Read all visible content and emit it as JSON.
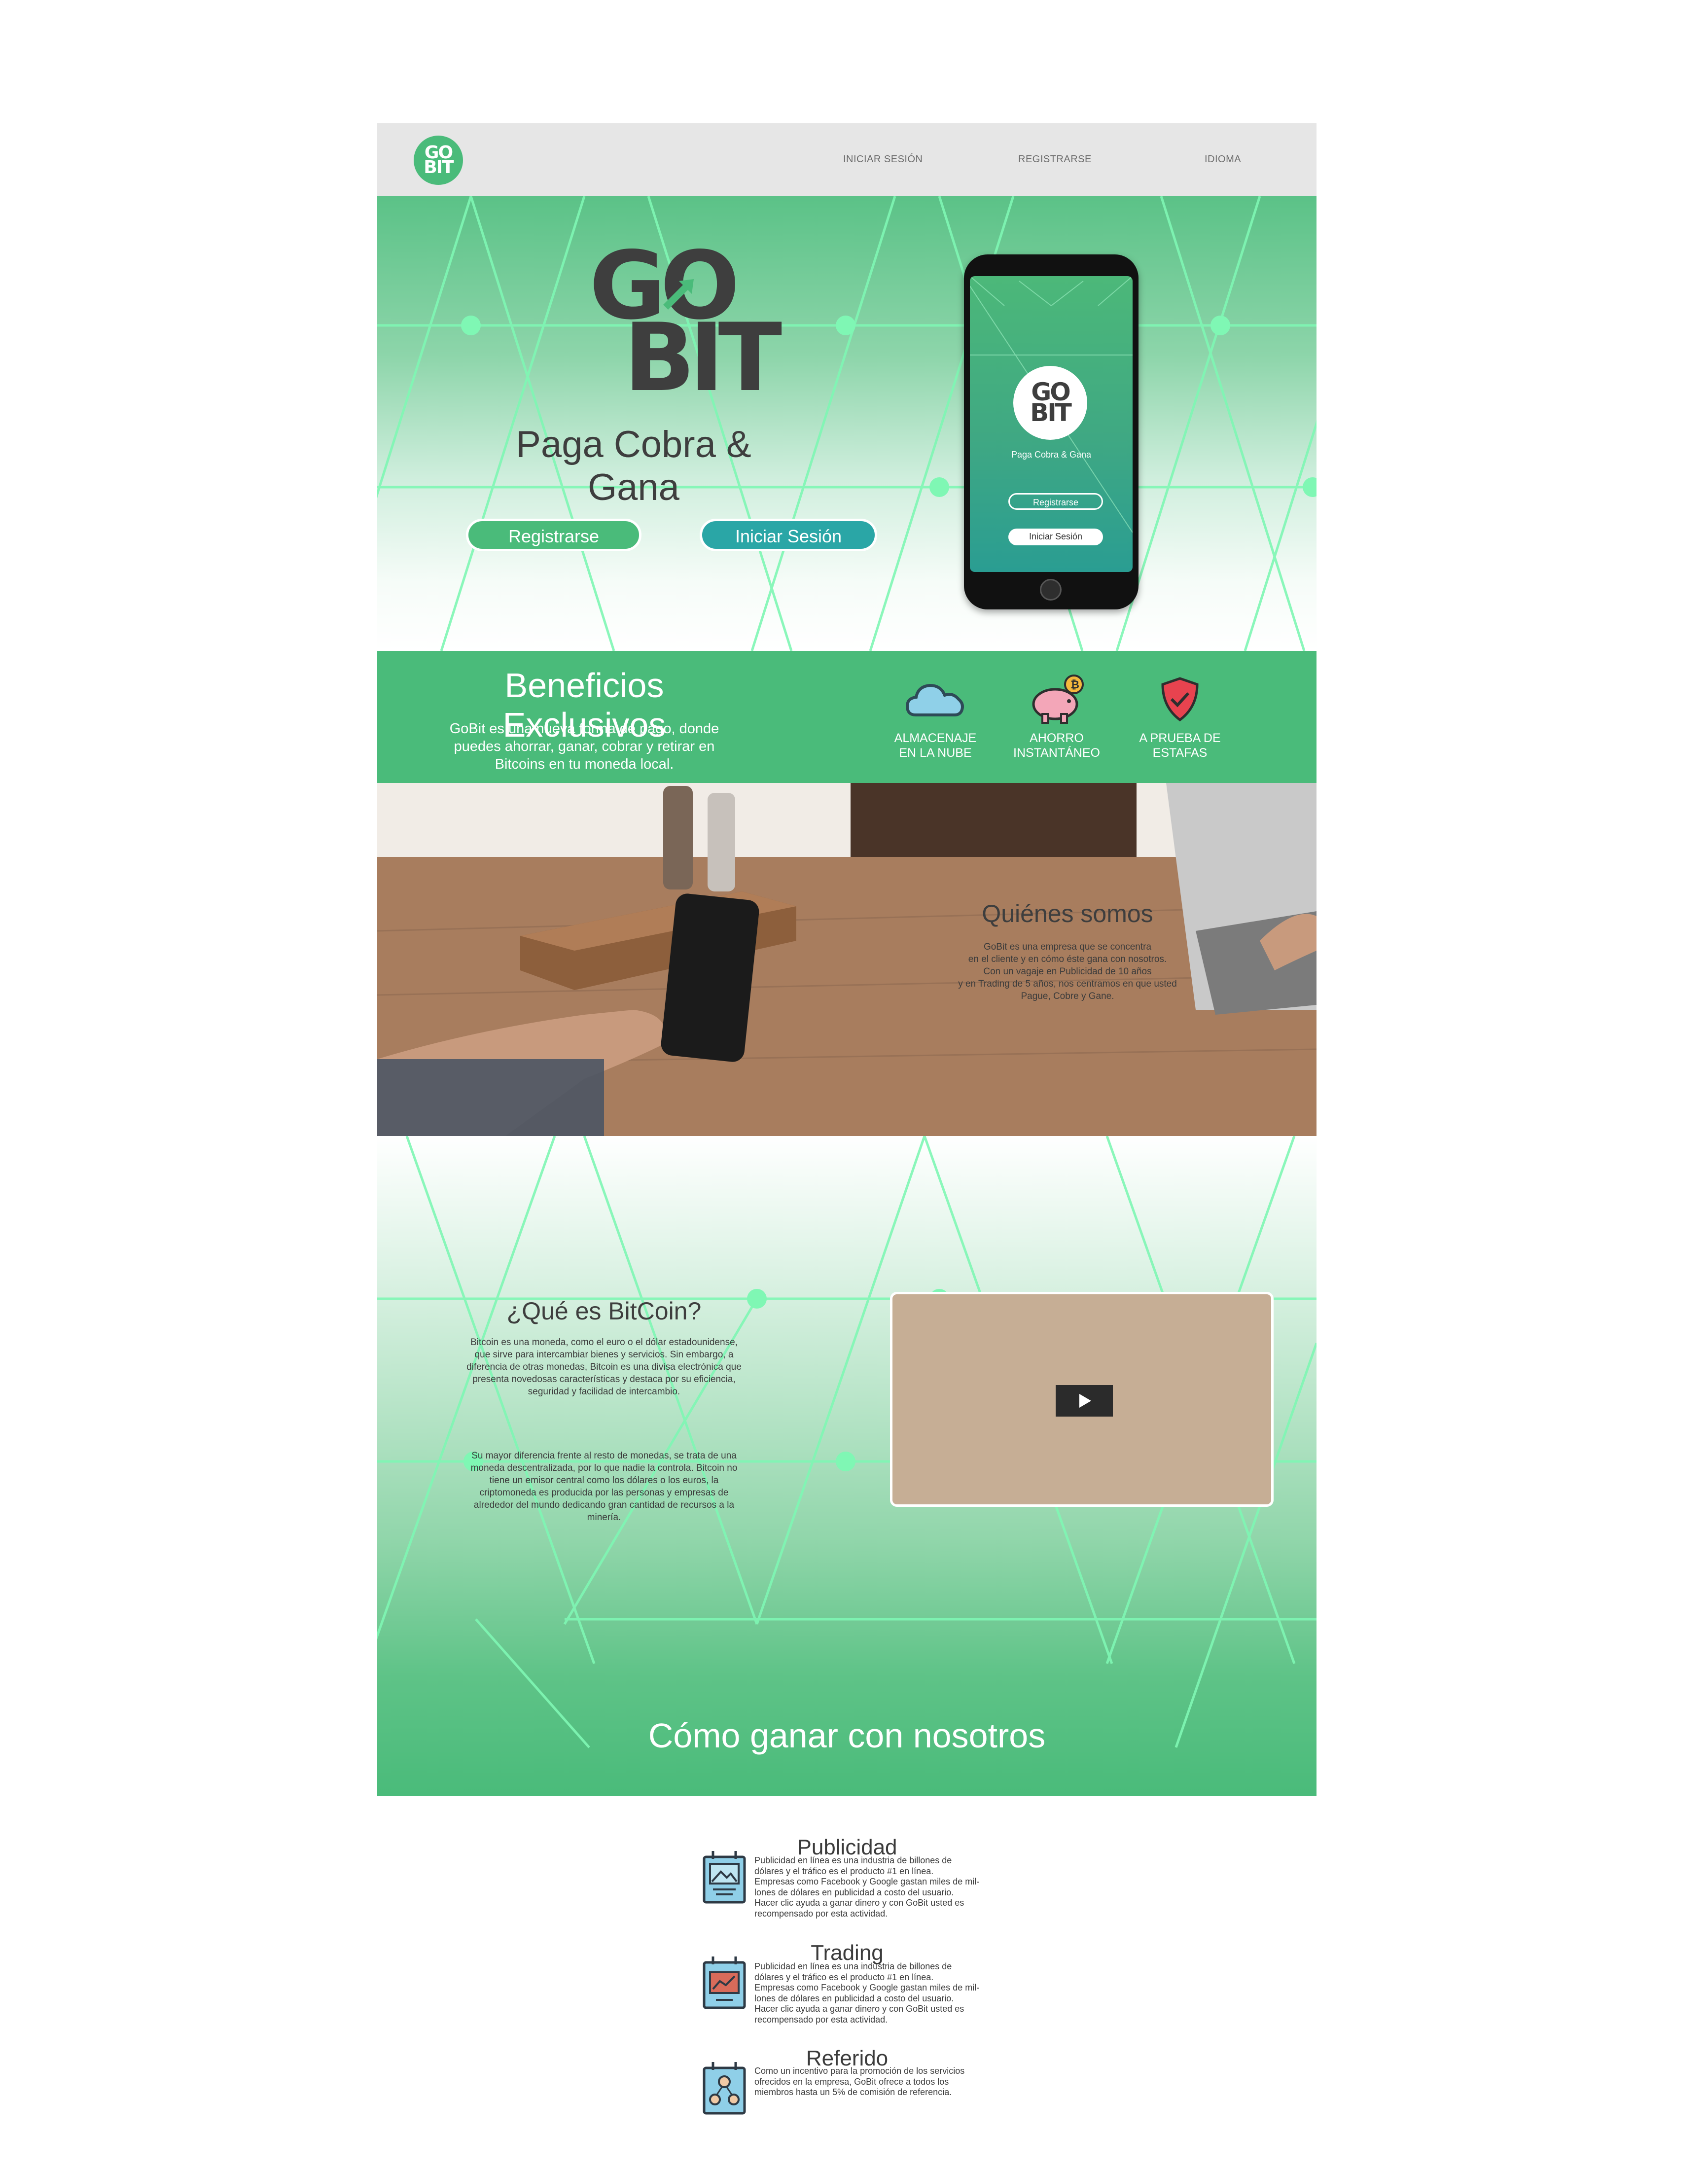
{
  "nav": {
    "logo_line1": "GO",
    "logo_line2": "BIT",
    "links": [
      "INICIAR SESIÓN",
      "REGISTRARSE",
      "IDIOMA"
    ]
  },
  "hero": {
    "logo_line1": "GO",
    "logo_line2": "BIT",
    "tagline": "Paga Cobra & Gana",
    "register_label": "Registrarse",
    "login_label": "Iniciar Sesión",
    "phone": {
      "logo_line1": "GO",
      "logo_line2": "BIT",
      "tagline": "Paga Cobra & Gana",
      "register_label": "Registrarse",
      "login_label": "Iniciar Sesión"
    }
  },
  "benefits": {
    "title": "Beneficios Exclusivos",
    "description": "GoBit es una nueva forma de pago, donde puedes ahorrar, ganar, cobrar y retirar en Bitcoins en tu moneda local.",
    "features": [
      {
        "line1": "ALMACENAJE",
        "line2": "EN LA NUBE",
        "icon": "cloud-icon"
      },
      {
        "line1": "AHORRO",
        "line2": "INSTANTÁNEO",
        "icon": "piggy-bank-icon"
      },
      {
        "line1": "A PRUEBA DE",
        "line2": "ESTAFAS",
        "icon": "shield-icon"
      }
    ]
  },
  "about": {
    "title": "Quiénes somos",
    "lines": [
      "GoBit es una empresa que se concentra",
      "en el cliente y en cómo éste gana con nosotros.",
      "Con un vagaje en Publicidad de 10 años",
      "y en Trading de 5 años, nos centramos en que usted",
      "Pague, Cobre y Gane."
    ]
  },
  "bitcoin": {
    "title": "¿Qué es BitCoin?",
    "paragraph1": "Bitcoin es una moneda, como el euro o el dólar estadounidense, que sirve para intercambiar bienes y servicios. Sin embargo, a diferencia de otras monedas, Bitcoin es una divisa electrónica que presenta novedosas características y destaca por su eficiencia, seguridad y facilidad de intercambio.",
    "paragraph2": "Su mayor diferencia frente al resto de monedas, se trata de una moneda descentralizada, por lo que nadie la controla. Bitcoin no tiene un emisor central como los dólares o los euros, la criptomoneda es producida por las personas y empresas de alrededor del mundo dedicando gran cantidad de recursos a la minería."
  },
  "earn": {
    "title": "Cómo ganar con nosotros",
    "items": [
      {
        "title": "Publicidad",
        "lines": [
          "Publicidad en línea es una industria de billones de",
          "dólares y el tráfico es el producto #1 en línea.",
          "Empresas como Facebook y Google gastan miles de mil-",
          "lones de dólares en publicidad a costo del usuario.",
          "Hacer clic ayuda a ganar dinero y con GoBit usted es",
          "recompensado por esta actividad."
        ]
      },
      {
        "title": "Trading",
        "lines": [
          "Publicidad en línea es una industria de billones de",
          "dólares y el tráfico es el producto #1 en línea.",
          "Empresas como Facebook y Google gastan miles de mil-",
          "lones de dólares en publicidad a costo del usuario.",
          "Hacer clic ayuda a ganar dinero y con GoBit usted es",
          "recompensado por esta actividad."
        ]
      },
      {
        "title": "Referido",
        "lines": [
          "Como un incentivo para la promoción de los servicios",
          "ofrecidos en la empresa, GoBit ofrece a todos los",
          "miembros hasta un 5% de comisión de referencia."
        ]
      }
    ]
  },
  "colors": {
    "brand_green": "#4abb7a",
    "teal": "#2aa6a6",
    "nav_bg": "#e6e6e6",
    "line_green": "#7ff7b4",
    "text_dark": "#3e3e3e"
  }
}
